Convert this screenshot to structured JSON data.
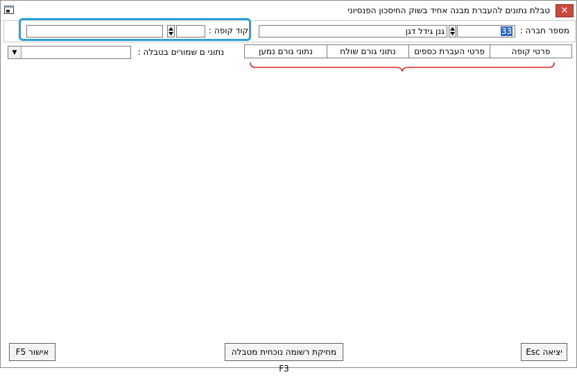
{
  "window": {
    "title": "טבלת נתונים להעברת מבנה אחיד בשוק החיסכון הפנסיוני",
    "close_icon": "close-icon",
    "app_icon": "app-icon"
  },
  "top_panel": {
    "company_number_label": "מספר חברה :",
    "company_number_value": "33",
    "company_name_value": "גנן גידל דגן",
    "fund_code_label": "קוד קופה :",
    "fund_code_value": "",
    "fund_name_value": ""
  },
  "tabs": [
    {
      "label": "פרטי קופה"
    },
    {
      "label": "פרטי העברת כספים"
    },
    {
      "label": "נתוני גורם שולח"
    },
    {
      "label": "נתוני גורם נמען"
    }
  ],
  "saved_data": {
    "label": "נתוני ם שמורים בטבלה :",
    "selected": ""
  },
  "buttons": {
    "exit": "יציאה Esc",
    "delete": "מחיקת רשומה נוכחית מטבלה F3",
    "confirm": "אישור F5"
  },
  "colors": {
    "highlight": "#2aa1dd",
    "bracket": "#e02020",
    "selection": "#3168c6",
    "close": "#c94a3c"
  }
}
